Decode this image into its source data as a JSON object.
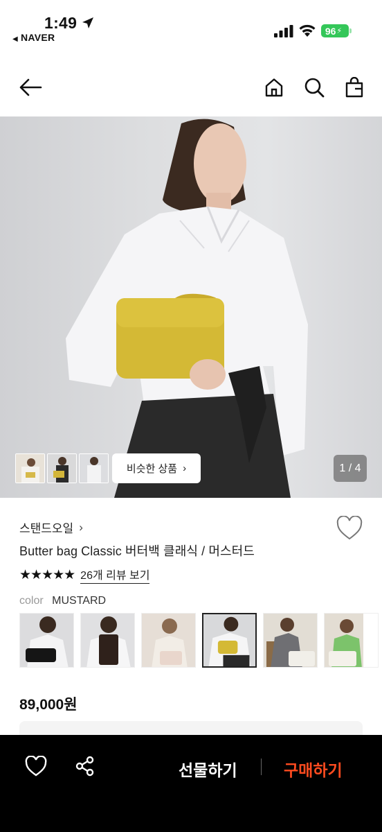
{
  "status_bar": {
    "time": "1:49",
    "back_app": "NAVER",
    "battery": "96"
  },
  "nav": {
    "back_icon": "back-arrow-icon",
    "home_icon": "home-icon",
    "search_icon": "search-icon",
    "bag_icon": "shopping-bag-icon"
  },
  "gallery": {
    "similar_label": "비슷한 상품",
    "counter": "1 / 4"
  },
  "product": {
    "brand": "스탠드오일",
    "name": "Butter bag Classic 버터백 클래식 / 머스터드",
    "rating_stars": 5,
    "review_link": "26개 리뷰 보기",
    "color_label": "color",
    "color_value": "MUSTARD",
    "price": "89,000원"
  },
  "bottom_bar": {
    "gift_label": "선물하기",
    "buy_label": "구매하기"
  },
  "colors": {
    "accent_buy": "#ff4b1f",
    "battery_green": "#34c759",
    "mustard": "#d4b935"
  }
}
